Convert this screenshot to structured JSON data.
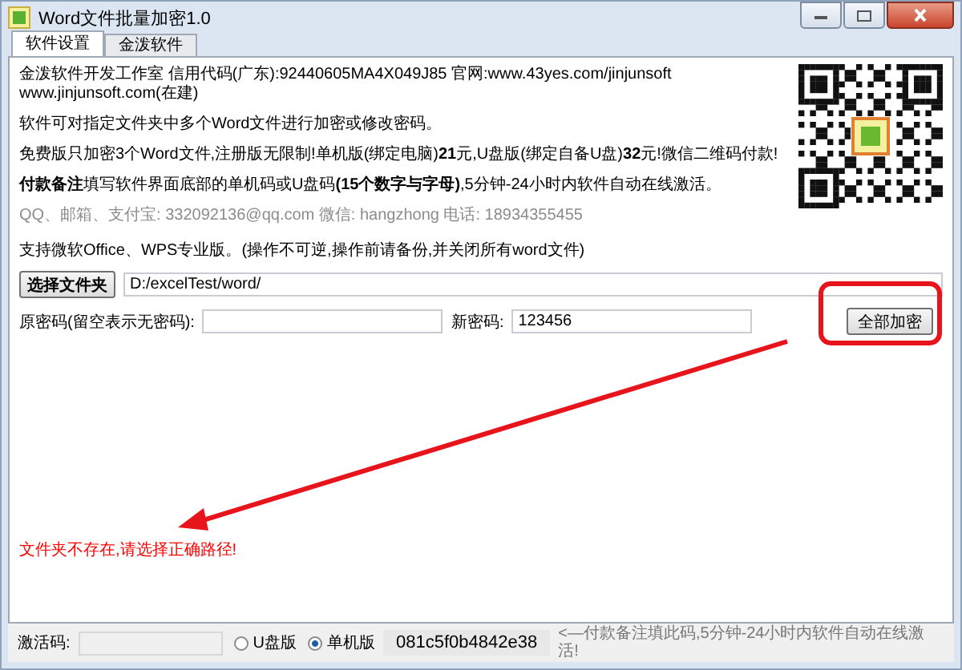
{
  "window": {
    "title": "Word文件批量加密1.0"
  },
  "tabs": [
    {
      "label": "软件设置",
      "selected": true
    },
    {
      "label": "金泼软件",
      "selected": false
    }
  ],
  "info_lines": [
    {
      "kind": "plain",
      "text": "金泼软件开发工作室 信用代码(广东):92440605MA4X049J85 官网:www.43yes.com/jinjunsoft  www.jinjunsoft.com(在建)"
    },
    {
      "kind": "plain",
      "text": "软件可对指定文件夹中多个Word文件进行加密或修改密码。"
    },
    {
      "kind": "plain",
      "text": "免费版只加密3个Word文件,注册版无限制!单机版(绑定电脑)**21**元,U盘版(绑定自备U盘)**32**元!微信二维码付款!"
    },
    {
      "kind": "plain",
      "text": "**付款备注**填写软件界面底部的单机码或U盘码**(15个数字与字母)**,5分钟-24小时内软件自动在线激活。"
    },
    {
      "kind": "muted",
      "text": "QQ、邮箱、支付宝: 332092136@qq.com    微信: hangzhong    电话: 18934355455"
    }
  ],
  "notice": "支持微软Office、WPS专业版。(操作不可逆,操作前请备份,并关闭所有word文件)",
  "folder": {
    "button": "选择文件夹",
    "value": "D:/excelTest/word/"
  },
  "password": {
    "old_label": "原密码(留空表示无密码):",
    "new_label": "新密码:",
    "new_value": "123456",
    "encrypt_button": "全部加密"
  },
  "error_message": "文件夹不存在,请选择正确路径!",
  "bottom": {
    "activation_label": "激活码:",
    "radios": [
      {
        "label": "U盘版",
        "selected": false
      },
      {
        "label": "单机版",
        "selected": true
      }
    ],
    "machine_code": "081c5f0b4842e38",
    "hint": "<—付款备注填此码,5分钟-24小时内软件自动在线激活!"
  }
}
